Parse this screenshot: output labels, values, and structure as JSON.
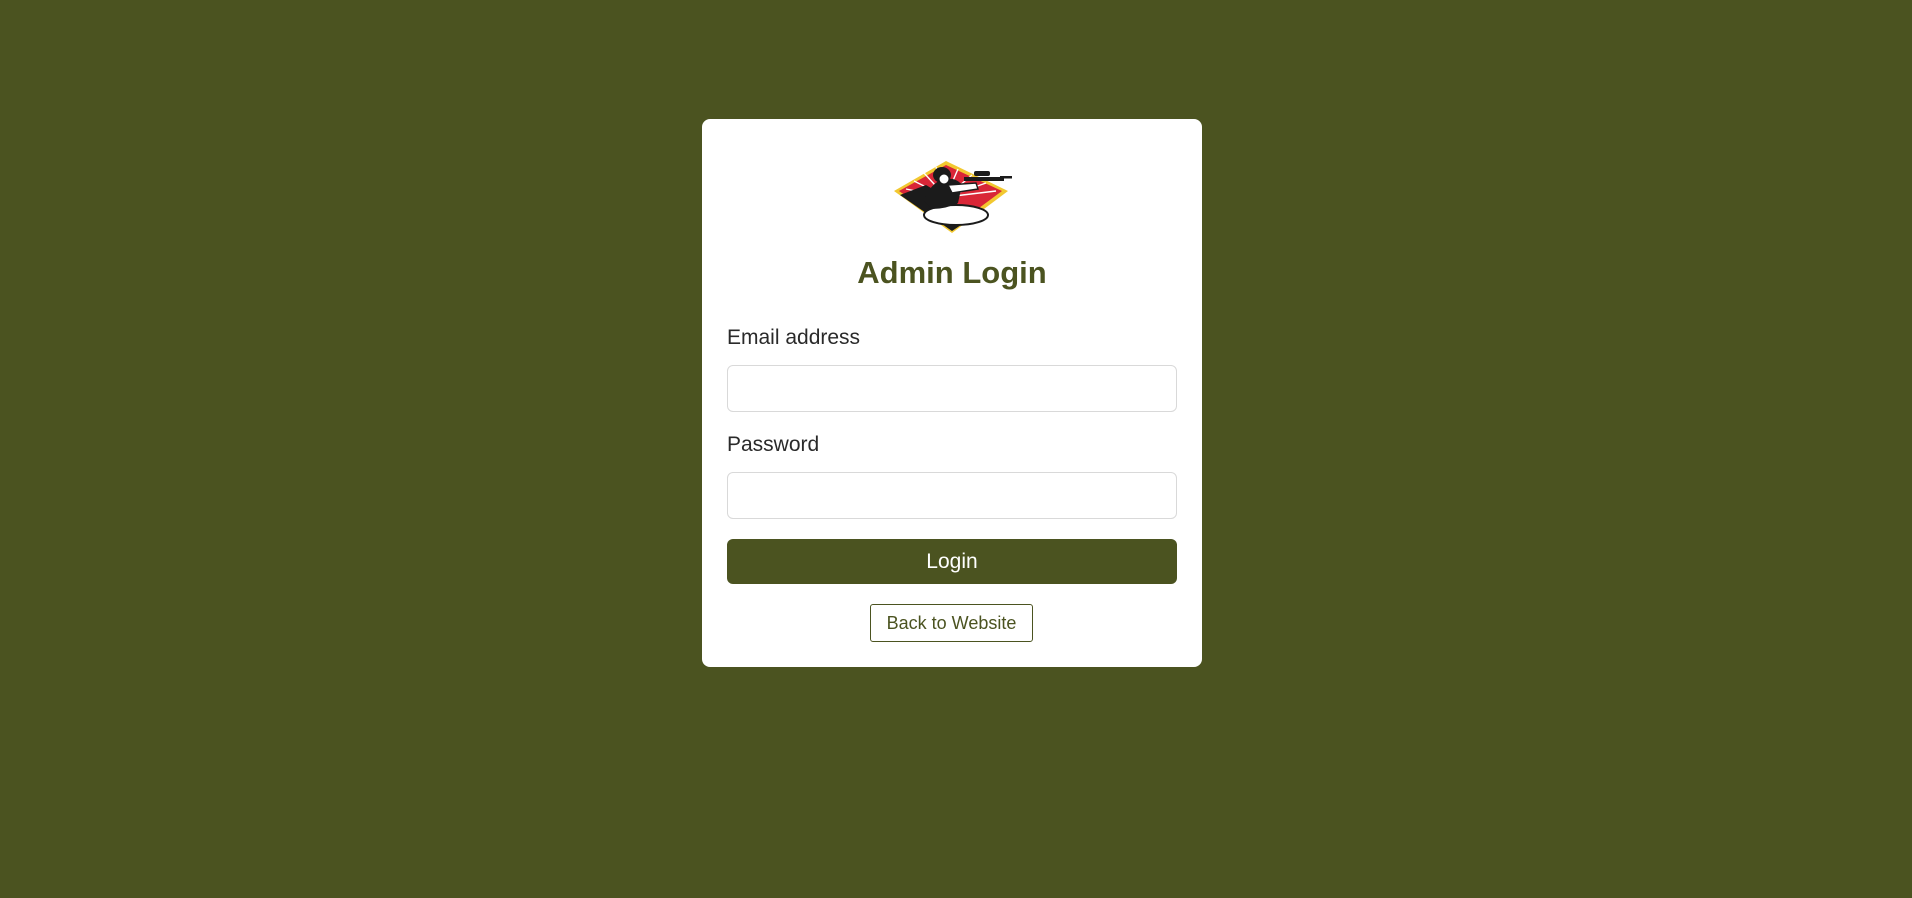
{
  "page": {
    "background_color": "#4b5320",
    "accent_color": "#4b5320"
  },
  "login_card": {
    "logo": "shooter-crest-logo",
    "title": "Admin Login",
    "email_label": "Email address",
    "email_value": "",
    "password_label": "Password",
    "password_value": "",
    "login_button": "Login",
    "back_button": "Back to Website"
  }
}
